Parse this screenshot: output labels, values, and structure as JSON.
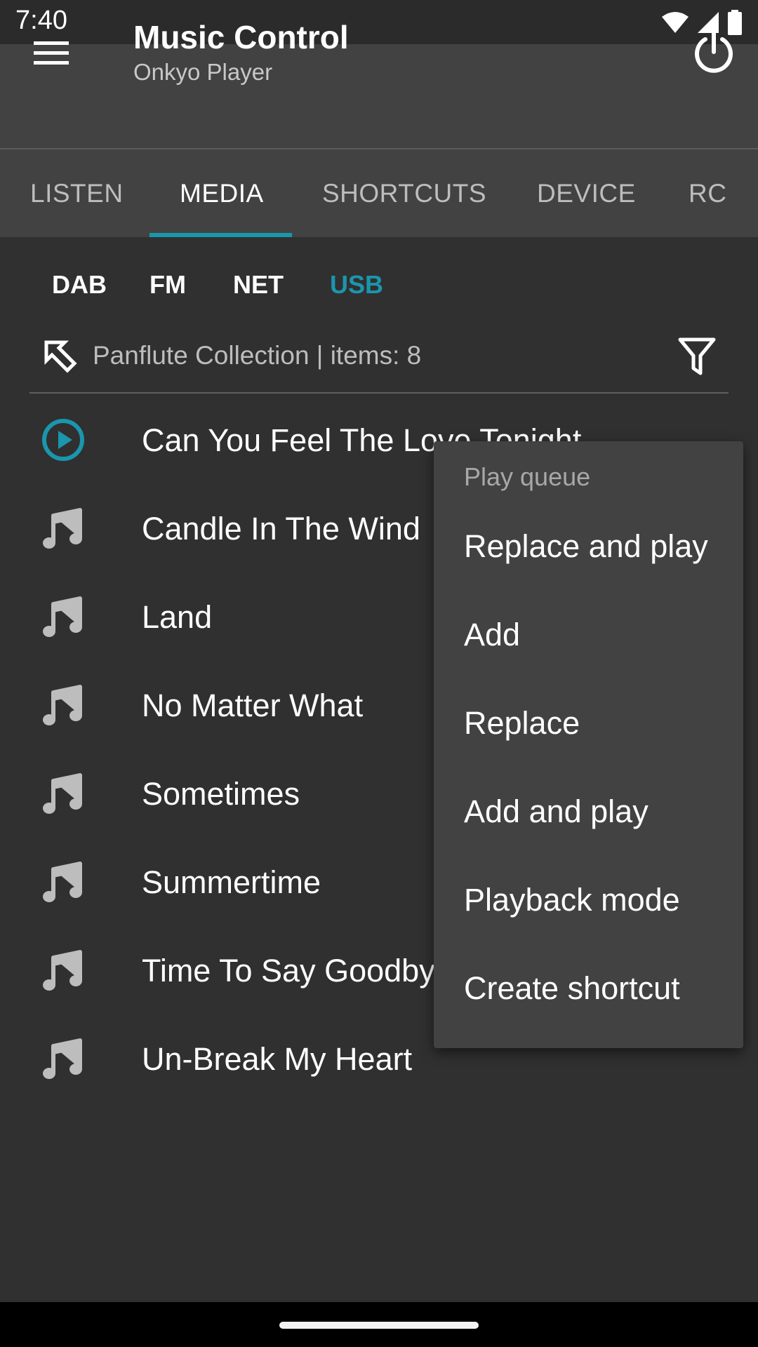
{
  "status": {
    "time": "7:40"
  },
  "appbar": {
    "title": "Music Control",
    "subtitle": "Onkyo Player"
  },
  "tabs": [
    {
      "label": "LISTEN",
      "active": false
    },
    {
      "label": "MEDIA",
      "active": true
    },
    {
      "label": "SHORTCUTS",
      "active": false
    },
    {
      "label": "DEVICE",
      "active": false
    },
    {
      "label": "RC",
      "active": false
    }
  ],
  "sources": [
    {
      "label": "DAB",
      "active": false
    },
    {
      "label": "FM",
      "active": false
    },
    {
      "label": "NET",
      "active": false
    },
    {
      "label": "USB",
      "active": true
    }
  ],
  "path": {
    "text": "Panflute Collection | items: 8"
  },
  "tracks": [
    {
      "title": "Can You Feel The Love Tonight",
      "icon": "play-circle-icon"
    },
    {
      "title": "Candle In The Wind",
      "icon": "music-note-icon"
    },
    {
      "title": "Land",
      "icon": "music-note-icon"
    },
    {
      "title": "No Matter What",
      "icon": "music-note-icon"
    },
    {
      "title": "Sometimes",
      "icon": "music-note-icon"
    },
    {
      "title": "Summertime",
      "icon": "music-note-icon"
    },
    {
      "title": "Time To Say Goodby",
      "icon": "music-note-icon"
    },
    {
      "title": "Un-Break My Heart",
      "icon": "music-note-icon"
    }
  ],
  "popup": {
    "header": "Play queue",
    "items": [
      "Replace and play",
      "Add",
      "Replace",
      "Add and play",
      "Playback mode",
      "Create shortcut"
    ]
  },
  "colors": {
    "accent": "#1a96ad",
    "appbar": "#424242",
    "background": "#303030"
  }
}
